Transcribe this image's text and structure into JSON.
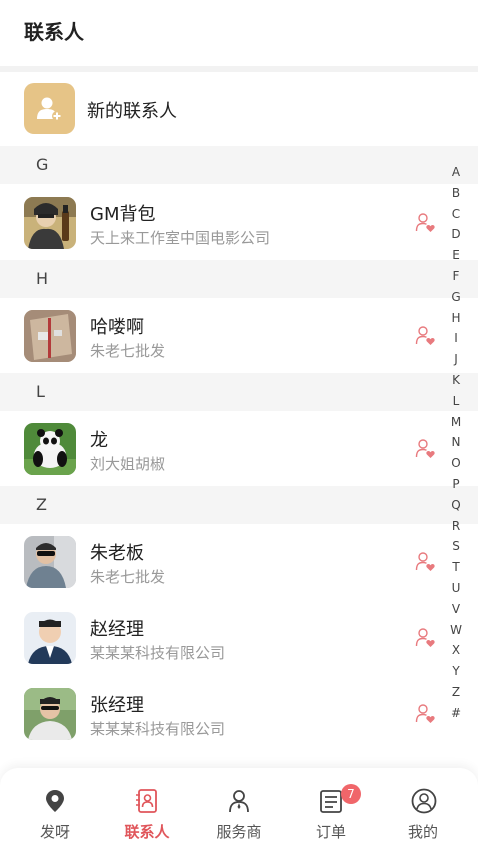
{
  "header": {
    "title": "联系人"
  },
  "new_contact": {
    "label": "新的联系人",
    "icon": "add-person-icon"
  },
  "sections": [
    {
      "letter": "G"
    },
    {
      "letter": "H"
    },
    {
      "letter": "L"
    },
    {
      "letter": "Z"
    }
  ],
  "contacts": [
    {
      "name": "GM背包",
      "subtitle": "天上来工作室中国电影公司"
    },
    {
      "name": "哈喽啊",
      "subtitle": "朱老七批发"
    },
    {
      "name": "龙",
      "subtitle": "刘大姐胡椒"
    },
    {
      "name": "朱老板",
      "subtitle": "朱老七批发"
    },
    {
      "name": "赵经理",
      "subtitle": "某某某科技有限公司"
    },
    {
      "name": "张经理",
      "subtitle": "某某某科技有限公司"
    }
  ],
  "alpha_index": [
    "A",
    "B",
    "C",
    "D",
    "E",
    "F",
    "G",
    "H",
    "I",
    "J",
    "K",
    "L",
    "M",
    "N",
    "O",
    "P",
    "Q",
    "R",
    "S",
    "T",
    "U",
    "V",
    "W",
    "X",
    "Y",
    "Z",
    "#"
  ],
  "tabbar": {
    "tabs": [
      {
        "label": "发呀",
        "icon": "location-pin-icon"
      },
      {
        "label": "联系人",
        "icon": "contacts-icon"
      },
      {
        "label": "服务商",
        "icon": "service-person-icon"
      },
      {
        "label": "订单",
        "icon": "order-list-icon",
        "badge": "7"
      },
      {
        "label": "我的",
        "icon": "profile-icon"
      }
    ]
  },
  "colors": {
    "accent": "#e0565b",
    "new_contact_bg": "#e6c487",
    "section_bg": "#f5f5f5",
    "subtitle": "#999999"
  }
}
